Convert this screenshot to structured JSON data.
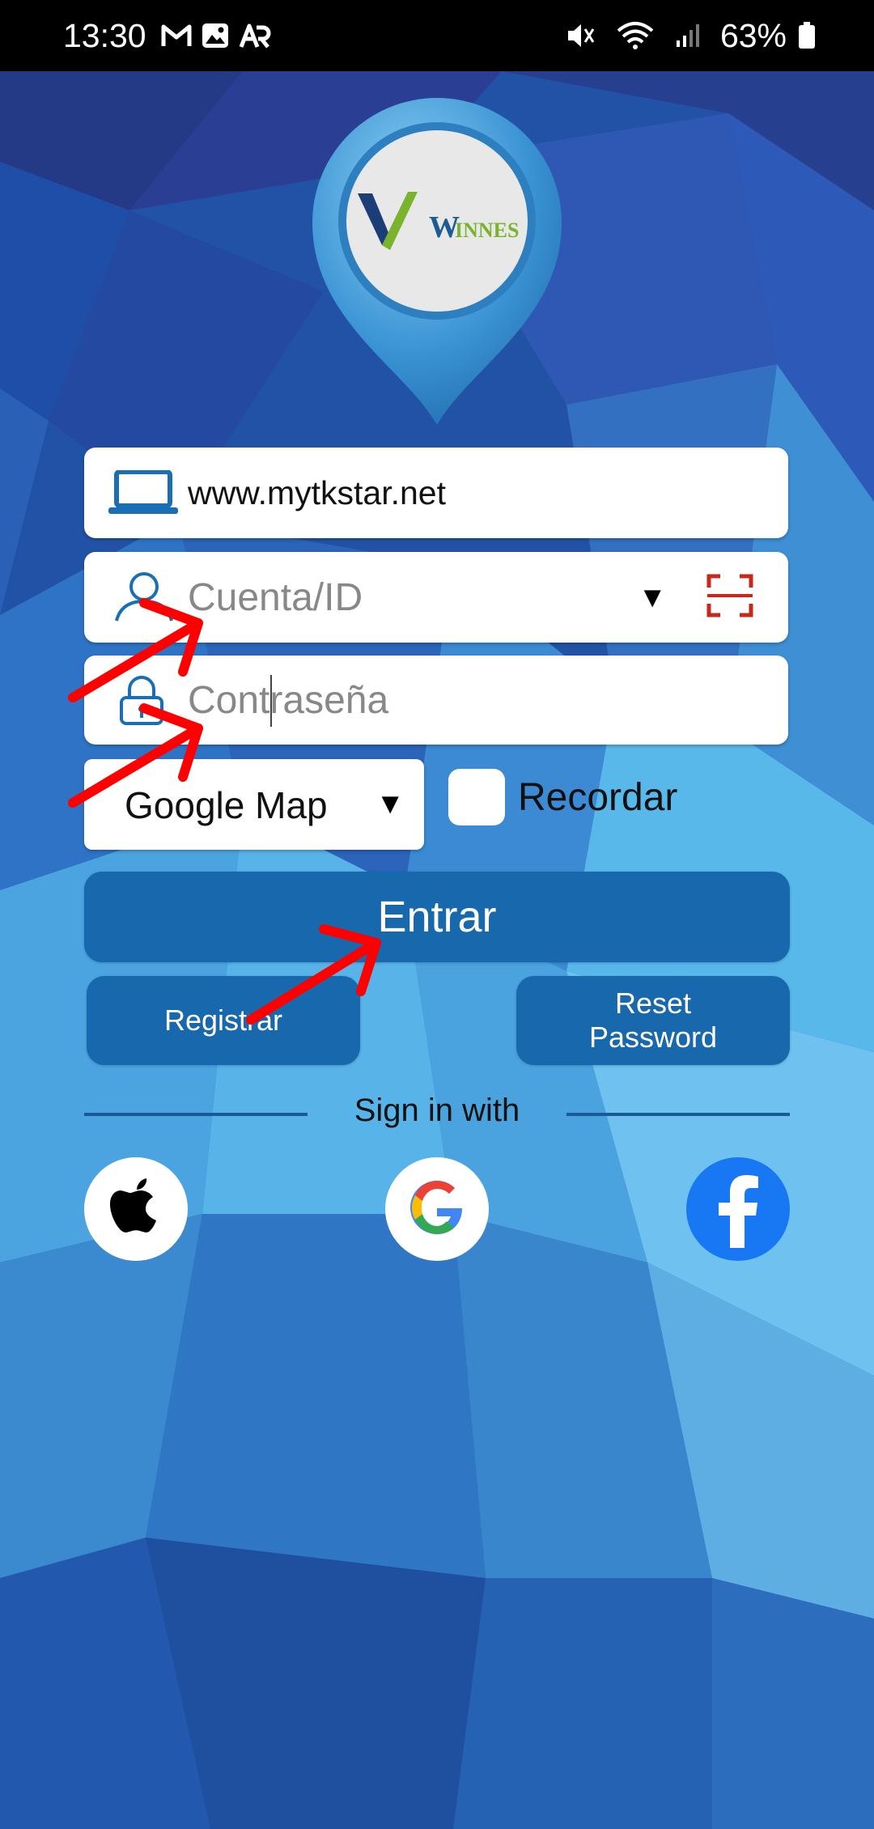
{
  "status_bar": {
    "time": "13:30",
    "battery": "63%",
    "left_icons": [
      "gmail-icon",
      "gallery-icon",
      "ar-icon"
    ],
    "right_icons": [
      "mute-icon",
      "wifi-icon",
      "signal-icon",
      "battery-icon"
    ]
  },
  "logo": {
    "brand": "WINNES"
  },
  "form": {
    "server_value": "www.mytkstar.net",
    "account_placeholder": "Cuenta/ID",
    "password_placeholder": "Contraseña",
    "map_selected": "Google Map",
    "remember_label": "Recordar",
    "remember_checked": false
  },
  "buttons": {
    "login": "Entrar",
    "register": "Registrar",
    "reset_line1": "Reset",
    "reset_line2": "Password"
  },
  "signin": {
    "label": "Sign in with",
    "providers": [
      "apple-icon",
      "google-icon",
      "facebook-icon"
    ]
  },
  "colors": {
    "button_blue": "#1768ad",
    "annotation_red": "#ff0000",
    "facebook_blue": "#1877f2"
  }
}
